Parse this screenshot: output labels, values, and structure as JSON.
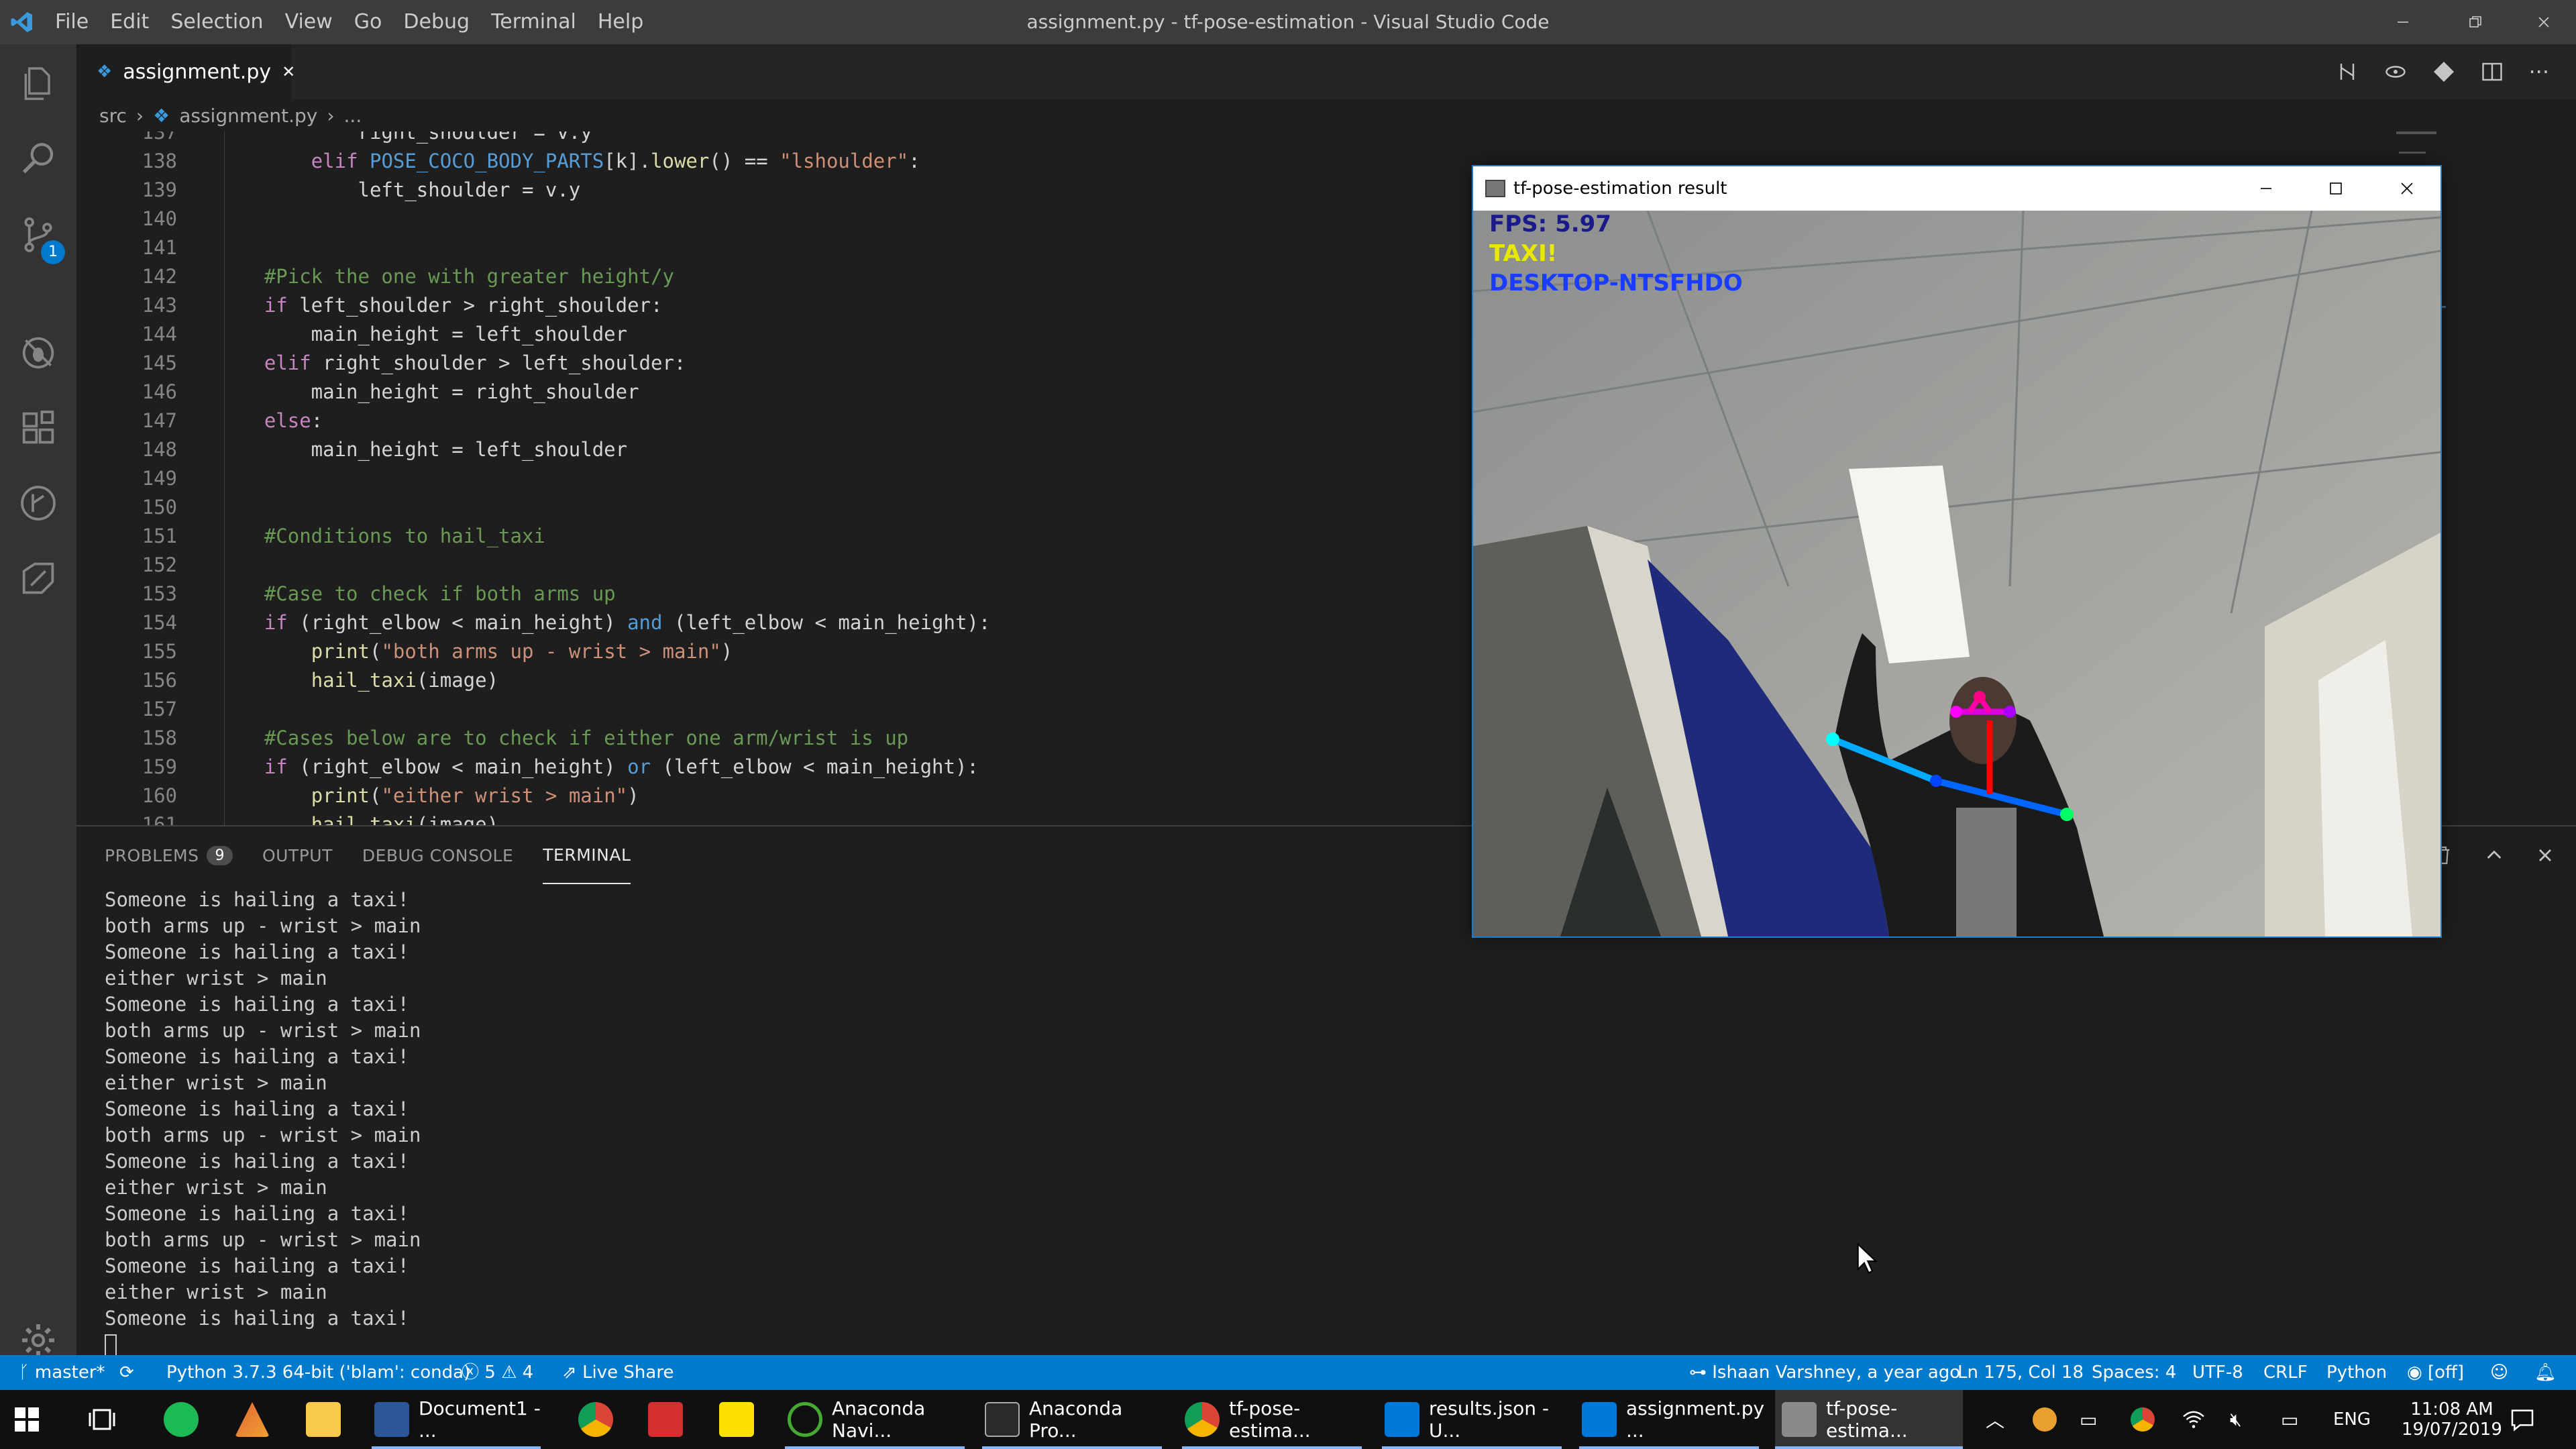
{
  "window": {
    "title": "assignment.py - tf-pose-estimation - Visual Studio Code",
    "menu": [
      "File",
      "Edit",
      "Selection",
      "View",
      "Go",
      "Debug",
      "Terminal",
      "Help"
    ]
  },
  "activity_bar": {
    "items": [
      "explorer-icon",
      "search-icon",
      "source-control-icon",
      "debug-icon",
      "extensions-icon",
      "git-history-icon",
      "remote-icon"
    ],
    "source_control_badge": "1"
  },
  "tabs": [
    {
      "label": "assignment.py",
      "close": "✕"
    }
  ],
  "breadcrumb": [
    "src",
    "›",
    "assignment.py",
    "›",
    "..."
  ],
  "editor": {
    "lines": [
      {
        "n": "137",
        "t": "            right_shoulder = v.y"
      },
      {
        "n": "138",
        "t": "        elif POSE_COCO_BODY_PARTS[k].lower() == \"lshoulder\":"
      },
      {
        "n": "139",
        "t": "            left_shoulder = v.y"
      },
      {
        "n": "140",
        "t": ""
      },
      {
        "n": "141",
        "t": ""
      },
      {
        "n": "142",
        "t": "    #Pick the one with greater height/y"
      },
      {
        "n": "143",
        "t": "    if left_shoulder > right_shoulder:"
      },
      {
        "n": "144",
        "t": "        main_height = left_shoulder"
      },
      {
        "n": "145",
        "t": "    elif right_shoulder > left_shoulder:"
      },
      {
        "n": "146",
        "t": "        main_height = right_shoulder"
      },
      {
        "n": "147",
        "t": "    else:"
      },
      {
        "n": "148",
        "t": "        main_height = left_shoulder"
      },
      {
        "n": "149",
        "t": ""
      },
      {
        "n": "150",
        "t": ""
      },
      {
        "n": "151",
        "t": "    #Conditions to hail_taxi"
      },
      {
        "n": "152",
        "t": ""
      },
      {
        "n": "153",
        "t": "    #Case to check if both arms up"
      },
      {
        "n": "154",
        "t": "    if (right_elbow < main_height) and (left_elbow < main_height):"
      },
      {
        "n": "155",
        "t": "        print(\"both arms up - wrist > main\")"
      },
      {
        "n": "156",
        "t": "        hail_taxi(image)"
      },
      {
        "n": "157",
        "t": ""
      },
      {
        "n": "158",
        "t": "    #Cases below are to check if either one arm/wrist is up"
      },
      {
        "n": "159",
        "t": "    if (right_elbow < main_height) or (left_elbow < main_height):"
      },
      {
        "n": "160",
        "t": "        print(\"either wrist > main\")"
      },
      {
        "n": "161",
        "t": "        hail_taxi(image)"
      }
    ]
  },
  "panel": {
    "tabs": [
      "PROBLEMS",
      "OUTPUT",
      "DEBUG CONSOLE",
      "TERMINAL"
    ],
    "problems_count": "9",
    "terminal_lines": [
      "Someone is hailing a taxi!",
      "both arms up - wrist > main",
      "Someone is hailing a taxi!",
      "either wrist > main",
      "Someone is hailing a taxi!",
      "both arms up - wrist > main",
      "Someone is hailing a taxi!",
      "either wrist > main",
      "Someone is hailing a taxi!",
      "both arms up - wrist > main",
      "Someone is hailing a taxi!",
      "either wrist > main",
      "Someone is hailing a taxi!",
      "both arms up - wrist > main",
      "Someone is hailing a taxi!",
      "either wrist > main",
      "Someone is hailing a taxi!"
    ]
  },
  "status_bar": {
    "branch": "master*",
    "python": "Python 3.7.3 64-bit ('blam': conda)",
    "errors": "5",
    "warnings": "4",
    "live_share": "Live Share",
    "blame": "Ishaan Varshney, a year ago",
    "position": "Ln 175, Col 18",
    "spaces": "Spaces: 4",
    "encoding": "UTF-8",
    "eol": "CRLF",
    "language": "Python",
    "off": "[off]"
  },
  "pose_window": {
    "title": "tf-pose-estimation result",
    "fps": "FPS: 5.97",
    "taxi": "TAXI!",
    "host": "DESKTOP-NTSFHDO",
    "colors": {
      "fps": "#1a1a8a",
      "taxi": "#e8e800",
      "host": "#1a3cff"
    }
  },
  "taskbar": {
    "apps": [
      {
        "label": "Document1 - ...",
        "icon": "word-icon"
      },
      {
        "label": "Anaconda Navi...",
        "icon": "anaconda-icon"
      },
      {
        "label": "Anaconda Pro...",
        "icon": "terminal-icon"
      },
      {
        "label": "tf-pose-estima...",
        "icon": "chrome-icon"
      },
      {
        "label": "results.json - U...",
        "icon": "vscode-icon"
      },
      {
        "label": "assignment.py ...",
        "icon": "vscode-icon"
      },
      {
        "label": "tf-pose-estima...",
        "icon": "window-icon"
      }
    ],
    "lang": "ENG",
    "time": "11:08 AM",
    "date": "19/07/2019"
  }
}
